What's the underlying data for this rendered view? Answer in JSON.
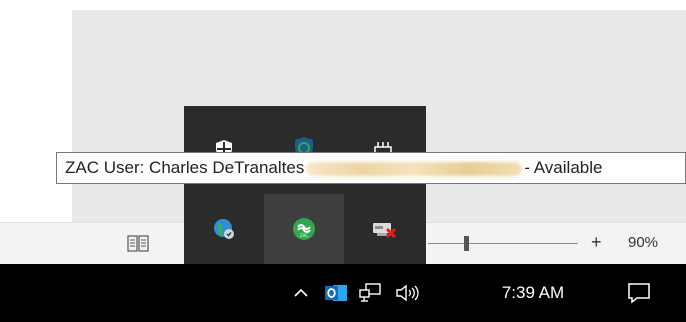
{
  "tooltip": {
    "prefix": "ZAC User: Charles DeTranaltes",
    "suffix": "- Available"
  },
  "status_bar": {
    "zoom_plus": "+",
    "zoom_level": "90%",
    "icons": [
      "read-mode-icon"
    ]
  },
  "tray_flyout": {
    "icons": [
      "security-shield-icon",
      "windows-defender-icon",
      "network-adapter-icon",
      "globe-vpn-icon",
      "zac-presence-icon",
      "disconnected-drive-icon"
    ]
  },
  "taskbar": {
    "time": "7:39 AM",
    "icons": [
      "chevron-up-icon",
      "outlook-icon",
      "network-icon",
      "volume-icon",
      "notifications-icon"
    ]
  },
  "colors": {
    "taskbar_bg": "#000000",
    "flyout_bg": "#2b2b2b",
    "zac_green": "#2fa84f",
    "outlook_blue": "#0f6cbd"
  }
}
